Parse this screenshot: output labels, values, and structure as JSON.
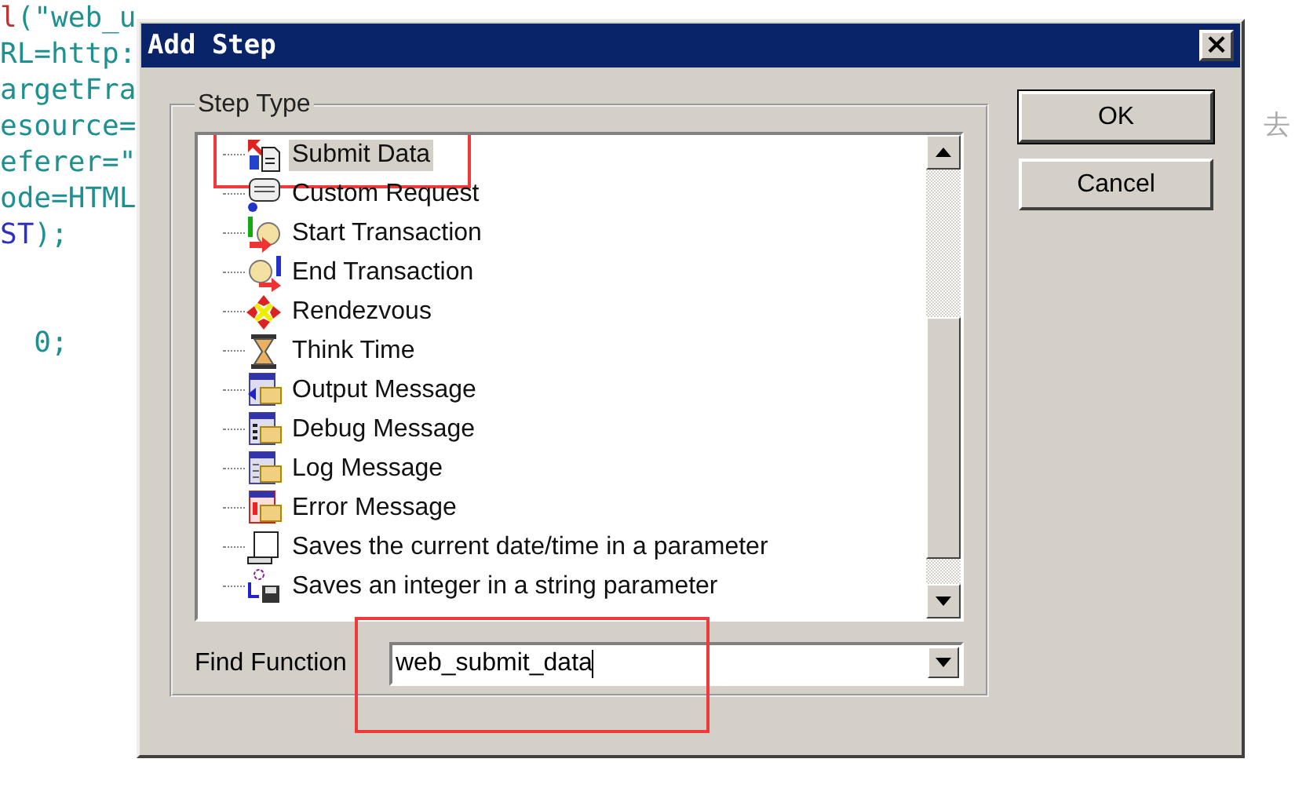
{
  "code_lines": [
    [
      {
        "kind": "keyword",
        "text": "l"
      },
      {
        "kind": "string",
        "text": "(\"web_u"
      }
    ],
    [
      {
        "kind": "string",
        "text": "RL=http:"
      }
    ],
    [
      {
        "kind": "string",
        "text": "argetFra"
      }
    ],
    [
      {
        "kind": "string",
        "text": "esource="
      }
    ],
    [
      {
        "kind": "string",
        "text": "eferer=\""
      }
    ],
    [
      {
        "kind": "string",
        "text": "ode=HTML"
      }
    ],
    [
      {
        "kind": "constant",
        "text": "ST"
      },
      {
        "kind": "plain",
        "text": ");"
      }
    ],
    [
      {
        "kind": "string",
        "text": "  0;"
      }
    ]
  ],
  "side_text": "去",
  "window": {
    "title": "Add Step",
    "close": "×"
  },
  "step_type": {
    "label": "Step Type",
    "items": [
      {
        "kind": "submit",
        "label": "Submit Data",
        "selected": true,
        "highlighted": true
      },
      {
        "kind": "request",
        "label": "Custom Request",
        "selected": false,
        "highlighted": false
      },
      {
        "kind": "start",
        "label": "Start Transaction",
        "selected": false,
        "highlighted": false
      },
      {
        "kind": "end",
        "label": "End Transaction",
        "selected": false,
        "highlighted": false
      },
      {
        "kind": "rendezvous",
        "label": "Rendezvous",
        "selected": false,
        "highlighted": false
      },
      {
        "kind": "think",
        "label": "Think Time",
        "selected": false,
        "highlighted": false
      },
      {
        "kind": "output",
        "label": "Output Message",
        "selected": false,
        "highlighted": false
      },
      {
        "kind": "debug",
        "label": "Debug Message",
        "selected": false,
        "highlighted": false
      },
      {
        "kind": "log",
        "label": "Log Message",
        "selected": false,
        "highlighted": false
      },
      {
        "kind": "error",
        "label": "Error Message",
        "selected": false,
        "highlighted": false
      },
      {
        "kind": "date",
        "label": "Saves the current date/time in a parameter",
        "selected": false,
        "highlighted": false
      },
      {
        "kind": "integer",
        "label": "Saves an integer in a string parameter",
        "selected": false,
        "highlighted": false
      }
    ]
  },
  "find_function": {
    "label": "Find Function",
    "value": "web_submit_data",
    "highlighted": true
  },
  "buttons": [
    "OK",
    "Cancel"
  ]
}
